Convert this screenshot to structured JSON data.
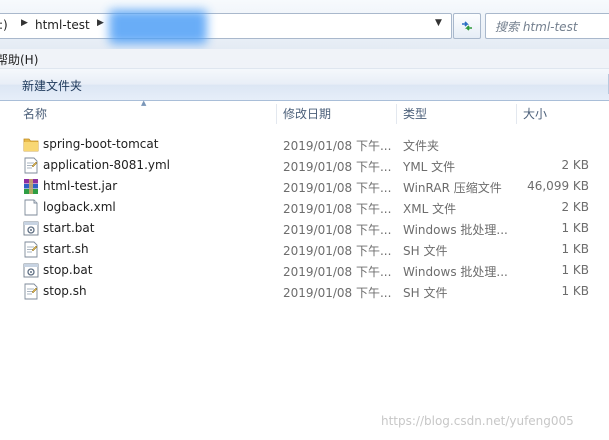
{
  "address_bar": {
    "drive_fragment": ":)",
    "crumbs": [
      "html-test"
    ],
    "search_placeholder": "搜索 html-test"
  },
  "menu": {
    "help_label": "帮助(H)"
  },
  "toolbar": {
    "new_folder_label": "新建文件夹"
  },
  "columns": {
    "name": "名称",
    "date": "修改日期",
    "type": "类型",
    "size": "大小"
  },
  "files": [
    {
      "name": "spring-boot-tomcat",
      "date": "2019/01/08 下午...",
      "type": "文件夹",
      "size": "",
      "icon": "folder-icon"
    },
    {
      "name": "application-8081.yml",
      "date": "2019/01/08 下午...",
      "type": "YML 文件",
      "size": "2 KB",
      "icon": "text-file-icon"
    },
    {
      "name": "html-test.jar",
      "date": "2019/01/08 下午...",
      "type": "WinRAR 压缩文件",
      "size": "46,099 KB",
      "icon": "winrar-archive-icon"
    },
    {
      "name": "logback.xml",
      "date": "2019/01/08 下午...",
      "type": "XML 文件",
      "size": "2 KB",
      "icon": "document-icon"
    },
    {
      "name": "start.bat",
      "date": "2019/01/08 下午...",
      "type": "Windows 批处理...",
      "size": "1 KB",
      "icon": "batch-file-icon"
    },
    {
      "name": "start.sh",
      "date": "2019/01/08 下午...",
      "type": "SH 文件",
      "size": "1 KB",
      "icon": "text-file-icon"
    },
    {
      "name": "stop.bat",
      "date": "2019/01/08 下午...",
      "type": "Windows 批处理...",
      "size": "1 KB",
      "icon": "batch-file-icon"
    },
    {
      "name": "stop.sh",
      "date": "2019/01/08 下午...",
      "type": "SH 文件",
      "size": "1 KB",
      "icon": "text-file-icon"
    }
  ],
  "watermark": "https://blog.csdn.net/yufeng005"
}
